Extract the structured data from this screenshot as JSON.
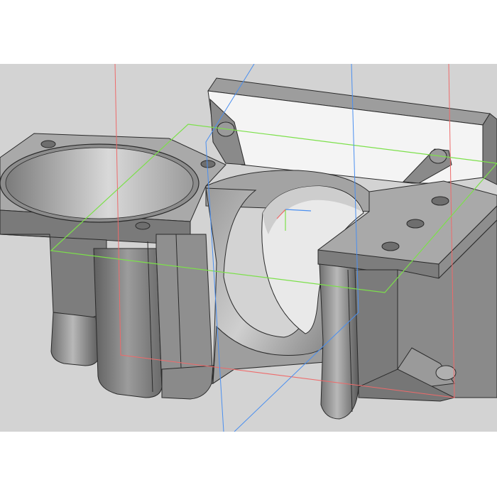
{
  "app": {
    "kind": "3D CAD modelling viewport",
    "background_color": "#d3d3d3",
    "margin_color": "#ffffff"
  },
  "model": {
    "description_icon": "cube-icon",
    "face_colors": {
      "top": "#a9a9a9",
      "side_light": "#bcbcbc",
      "side_mid": "#8e8e8e",
      "side_dark": "#6e6e6e",
      "inner_bright": "#f4f4f4",
      "edge": "#2a2a2a"
    }
  },
  "reference_geometry": {
    "plane_colors": {
      "front": "#ee6a6a",
      "top": "#7ce04a",
      "right": "#4a8ff0"
    },
    "origin_triad_colors": {
      "x": "#4a8ff0",
      "y": "#7ce04a",
      "z": "#ee6a6a"
    }
  }
}
